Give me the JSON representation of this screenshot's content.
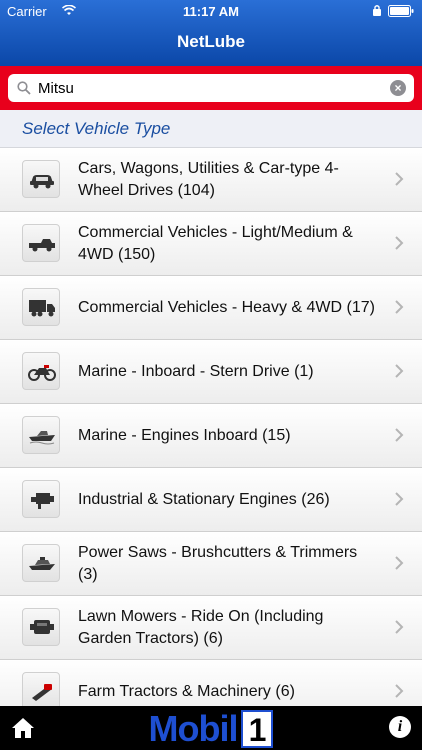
{
  "status_bar": {
    "carrier": "Carrier",
    "time": "11:17 AM"
  },
  "nav": {
    "title": "NetLube"
  },
  "search": {
    "value": "Mitsu",
    "clear_icon": "clear-icon"
  },
  "section": {
    "title": "Select Vehicle Type"
  },
  "vehicle_types": [
    {
      "label": "Cars, Wagons, Utilities & Car-type 4-Wheel Drives (104)",
      "icon": "car-icon"
    },
    {
      "label": "Commercial Vehicles - Light/Medium & 4WD (150)",
      "icon": "pickup-truck-icon"
    },
    {
      "label": "Commercial Vehicles - Heavy & 4WD (17)",
      "icon": "heavy-truck-icon"
    },
    {
      "label": "Marine - Inboard - Stern Drive (1)",
      "icon": "motorcycle-icon"
    },
    {
      "label": "Marine - Engines Inboard (15)",
      "icon": "boat-icon"
    },
    {
      "label": "Industrial & Stationary Engines (26)",
      "icon": "engine-icon"
    },
    {
      "label": "Power Saws - Brushcutters & Trimmers (3)",
      "icon": "yacht-icon"
    },
    {
      "label": "Lawn Mowers - Ride On (Including Garden Tractors) (6)",
      "icon": "engine-block-icon"
    },
    {
      "label": "Farm Tractors & Machinery (6)",
      "icon": "chainsaw-icon"
    }
  ],
  "bottom_bar": {
    "logo_text": "Mobil",
    "logo_number": "1",
    "info_label": "i"
  },
  "colors": {
    "nav_blue": "#0b47a8",
    "search_red": "#e8001c",
    "section_text": "#1a4ea1"
  }
}
